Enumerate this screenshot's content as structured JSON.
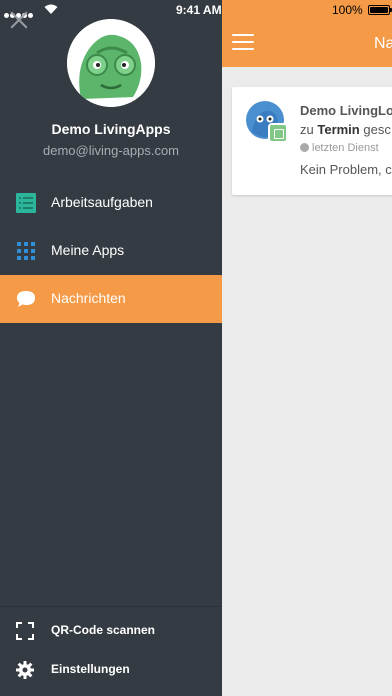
{
  "status_bar": {
    "time": "9:41 AM",
    "battery": "100%"
  },
  "drawer": {
    "user_name": "Demo LivingApps",
    "user_email": "demo@living-apps.com",
    "nav_items": [
      {
        "label": "Arbeitsaufgaben",
        "icon": "task-list-icon",
        "active": false
      },
      {
        "label": "Meine Apps",
        "icon": "apps-grid-icon",
        "active": false
      },
      {
        "label": "Nachrichten",
        "icon": "chat-bubble-icon",
        "active": true
      }
    ],
    "bottom_items": [
      {
        "label": "QR-Code scannen",
        "icon": "qr-scan-icon"
      },
      {
        "label": "Einstellungen",
        "icon": "gear-icon"
      }
    ]
  },
  "main": {
    "title": "Na",
    "message": {
      "sender": "Demo LivingLo",
      "line_prefix": "zu",
      "line_bold": "Termin",
      "line_suffix": "gesc",
      "meta": "letzten Dienst",
      "preview": "Kein Problem, c"
    }
  },
  "colors": {
    "accent": "#f59a47",
    "drawer_bg": "#353b42",
    "content_bg": "#ebebeb"
  }
}
